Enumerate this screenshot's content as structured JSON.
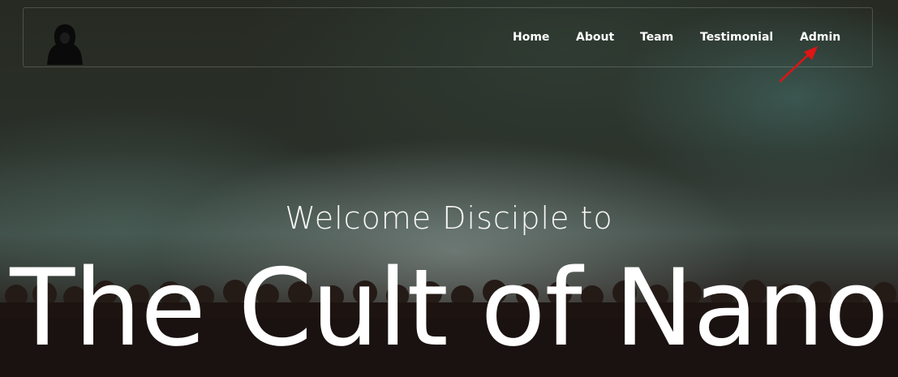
{
  "nav": {
    "logo_icon": "hooded-figure-icon",
    "links": [
      {
        "label": "Home"
      },
      {
        "label": "About"
      },
      {
        "label": "Team"
      },
      {
        "label": "Testimonial"
      },
      {
        "label": "Admin"
      }
    ]
  },
  "annotation": {
    "icon": "red-arrow-icon",
    "color": "#e01414"
  },
  "hero": {
    "welcome": "Welcome Disciple to",
    "title": "The Cult of Nano"
  }
}
